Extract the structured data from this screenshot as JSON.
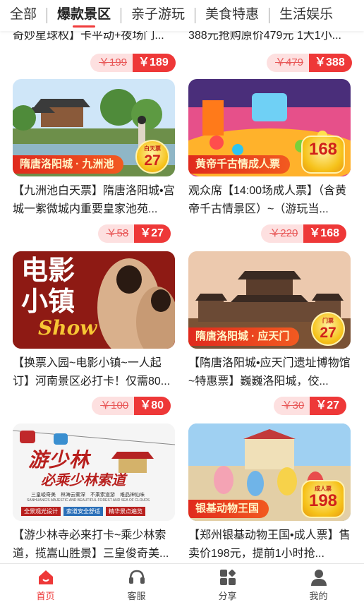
{
  "tabs": [
    {
      "label": "全部",
      "active": false
    },
    {
      "label": "爆款景区",
      "active": true
    },
    {
      "label": "亲子游玩",
      "active": false
    },
    {
      "label": "美食特惠",
      "active": false
    },
    {
      "label": "生活娱乐",
      "active": false
    }
  ],
  "partial_row": [
    {
      "title_fragment": "奇妙星球权】卡平动+夜场门...",
      "orig_price": "￥199",
      "price": "￥189"
    },
    {
      "title_fragment": "388元抢购原价479元 1大1小...",
      "orig_price": "￥479",
      "price": "￥388"
    }
  ],
  "products": [
    {
      "title": "【九洲池白天票】隋唐洛阳城•宫城一紫微城内重要皇家池苑...",
      "orig_price": "￥58",
      "price": "￥27",
      "image": {
        "ribbon": "隋唐洛阳城 · 九洲池",
        "badge_top": "白天票",
        "badge_price": "27"
      }
    },
    {
      "title": "观众席【14:00场成人票】（含黄帝千古情景区）~（游玩当...",
      "orig_price": "￥220",
      "price": "￥168",
      "image": {
        "ribbon": "黄帝千古情成人票",
        "badge_top": "",
        "badge_price": "168"
      }
    },
    {
      "title": "【换票入园~电影小镇~一人起订】河南景区必打卡！仅需80...",
      "orig_price": "￥100",
      "price": "￥80",
      "image": {
        "headline": "电影小镇",
        "script": "Show"
      }
    },
    {
      "title": "【隋唐洛阳城•应天门遗址博物馆~特惠票】巍巍洛阳城，佼...",
      "orig_price": "￥30",
      "price": "￥27",
      "image": {
        "ribbon": "隋唐洛阳城 · 应天门",
        "badge_top": "门票",
        "badge_price": "27"
      }
    },
    {
      "title": "【游少林寺必来打卡~乘少林索道，揽嵩山胜景】三皇俊奇美...",
      "orig_price": "",
      "price": "",
      "image": {
        "headline": "游少林",
        "subhead": "必乘少林索道",
        "tagline": "三皇峻奇美　林海云雾深　不乘索道游　难品神仙味",
        "english": "SANHUANG'S MAJESTIC AND BEAUTIFUL FOREST AND SEA OF CLOUDS",
        "tags": [
          "全景观光设计",
          "索道安全舒适",
          "精华景点遍览"
        ]
      }
    },
    {
      "title": "【郑州银基动物王国•成人票】售卖价198元，提前1小时抢...",
      "orig_price": "",
      "price": "",
      "image": {
        "ribbon": "银基动物王国",
        "badge_top": "成人票",
        "badge_price": "198"
      }
    }
  ],
  "bottom_nav": [
    {
      "label": "首页",
      "icon": "home-icon",
      "active": true
    },
    {
      "label": "客服",
      "icon": "headset-icon",
      "active": false
    },
    {
      "label": "分享",
      "icon": "share-icon",
      "active": false
    },
    {
      "label": "我的",
      "icon": "user-icon",
      "active": false
    }
  ],
  "colors": {
    "accent": "#ee3838",
    "price_bg_light": "#fde0e0",
    "ribbon": "#e02a1d"
  }
}
